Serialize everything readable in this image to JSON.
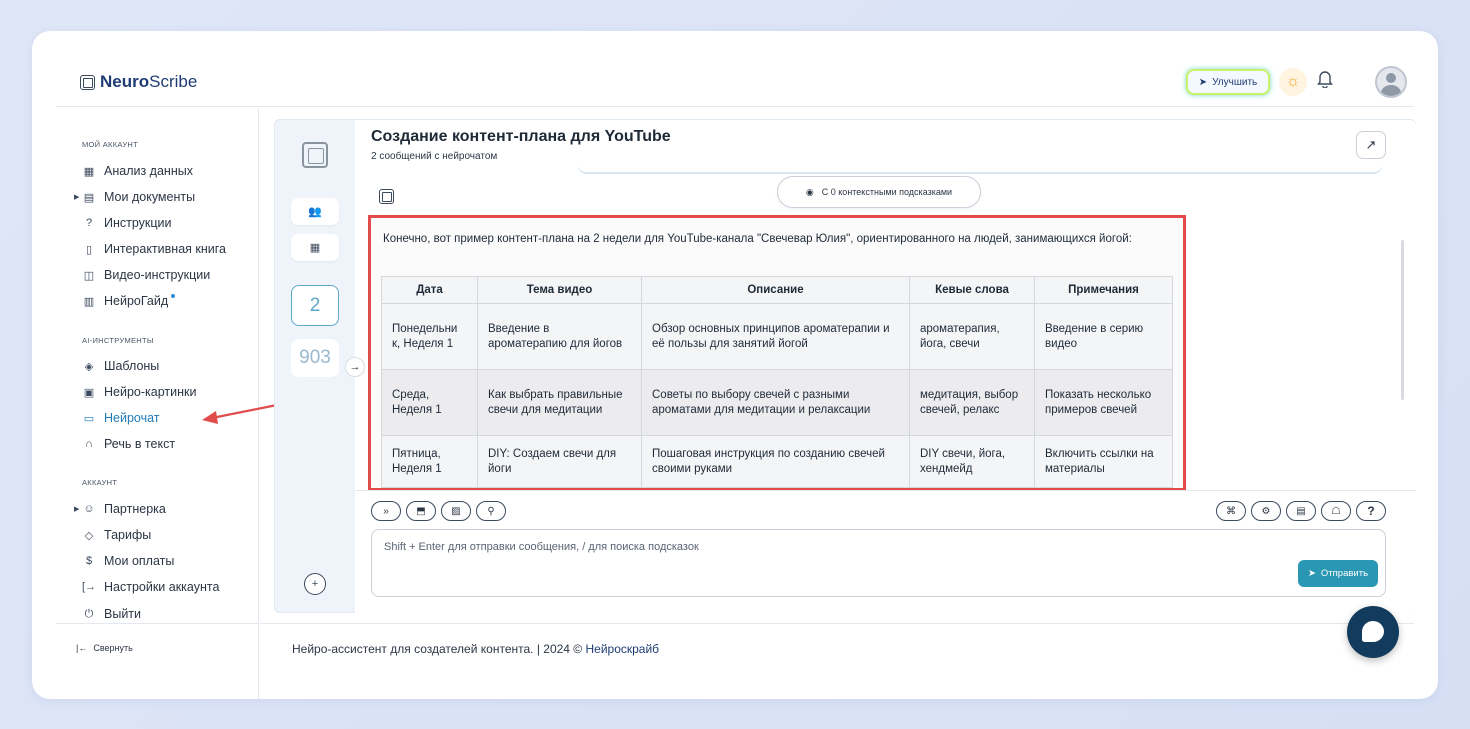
{
  "header": {
    "logo_bold": "Neuro",
    "logo_light": "Scribe",
    "upgrade_label": "Улучшить"
  },
  "sidebar": {
    "sections": [
      {
        "title": "МОЙ АККАУНТ"
      },
      {
        "title": "AI-ИНСТРУМЕНТЫ"
      },
      {
        "title": "АККАУНТ"
      }
    ],
    "items": [
      {
        "label": "Анализ данных",
        "icon": "grid-icon"
      },
      {
        "label": "Мои документы",
        "icon": "document-icon"
      },
      {
        "label": "Инструкции",
        "icon": "help-circle-icon"
      },
      {
        "label": "Интерактивная книга",
        "icon": "book-icon"
      },
      {
        "label": "Видео-инструкции",
        "icon": "video-icon"
      },
      {
        "label": "НейроГайд",
        "icon": "layout-icon"
      },
      {
        "label": "Шаблоны",
        "icon": "layers-icon"
      },
      {
        "label": "Нейро-картинки",
        "icon": "image-icon"
      },
      {
        "label": "Нейрочат",
        "icon": "chat-icon"
      },
      {
        "label": "Речь в текст",
        "icon": "headphones-icon"
      },
      {
        "label": "Партнерка",
        "icon": "users-icon"
      },
      {
        "label": "Тарифы",
        "icon": "tag-icon"
      },
      {
        "label": "Мои оплаты",
        "icon": "dollar-icon"
      },
      {
        "label": "Настройки аккаунта",
        "icon": "login-icon"
      },
      {
        "label": "Выйти",
        "icon": "power-icon"
      }
    ],
    "collapse_label": "Свернуть"
  },
  "rail": {
    "count_main": "2",
    "count_secondary": "903"
  },
  "chat": {
    "title": "Создание контент-плана для YouTube",
    "subtitle": "2 сообщений с нейрочатом",
    "context_pill": "С 0 контекстными подсказками",
    "message_text": "Конечно, вот пример контент-плана на 2 недели для YouTube-канала \"Свечевар Юлия\", ориентированного на людей, занимающихся йогой:",
    "table": {
      "headers": [
        "Дата",
        "Тема видео",
        "Описание",
        "Кевые слова",
        "Примечания"
      ],
      "rows": [
        [
          "Понедельни к, Неделя 1",
          "Введение в ароматерапию для йогов",
          "Обзор основных принципов ароматерапии и её пользы для занятий йогой",
          "ароматерапия, йога, свечи",
          "Введение в серию видео"
        ],
        [
          "Среда, Неделя 1",
          "Как выбрать правильные свечи для медитации",
          "Советы по выбору свечей с разными ароматами для медитации и релаксации",
          "медитация, выбор свечей, релакс",
          "Показать несколько примеров свечей"
        ],
        [
          "Пятница, Неделя 1",
          "DIY: Создаем свечи для йоги",
          "Пошаговая инструкция по созданию свечей своими руками",
          "DIY свечи, йога, хендмейд",
          "Включить ссылки на материалы"
        ]
      ]
    },
    "input_placeholder": "Shift + Enter для отправки сообщения, / для поиска подсказок",
    "send_label": "Отправить",
    "help_label": "?"
  },
  "footer": {
    "text": "Нейро-ассистент для создателей контента.  | 2024 © ",
    "link": "Нейроскрайб"
  }
}
